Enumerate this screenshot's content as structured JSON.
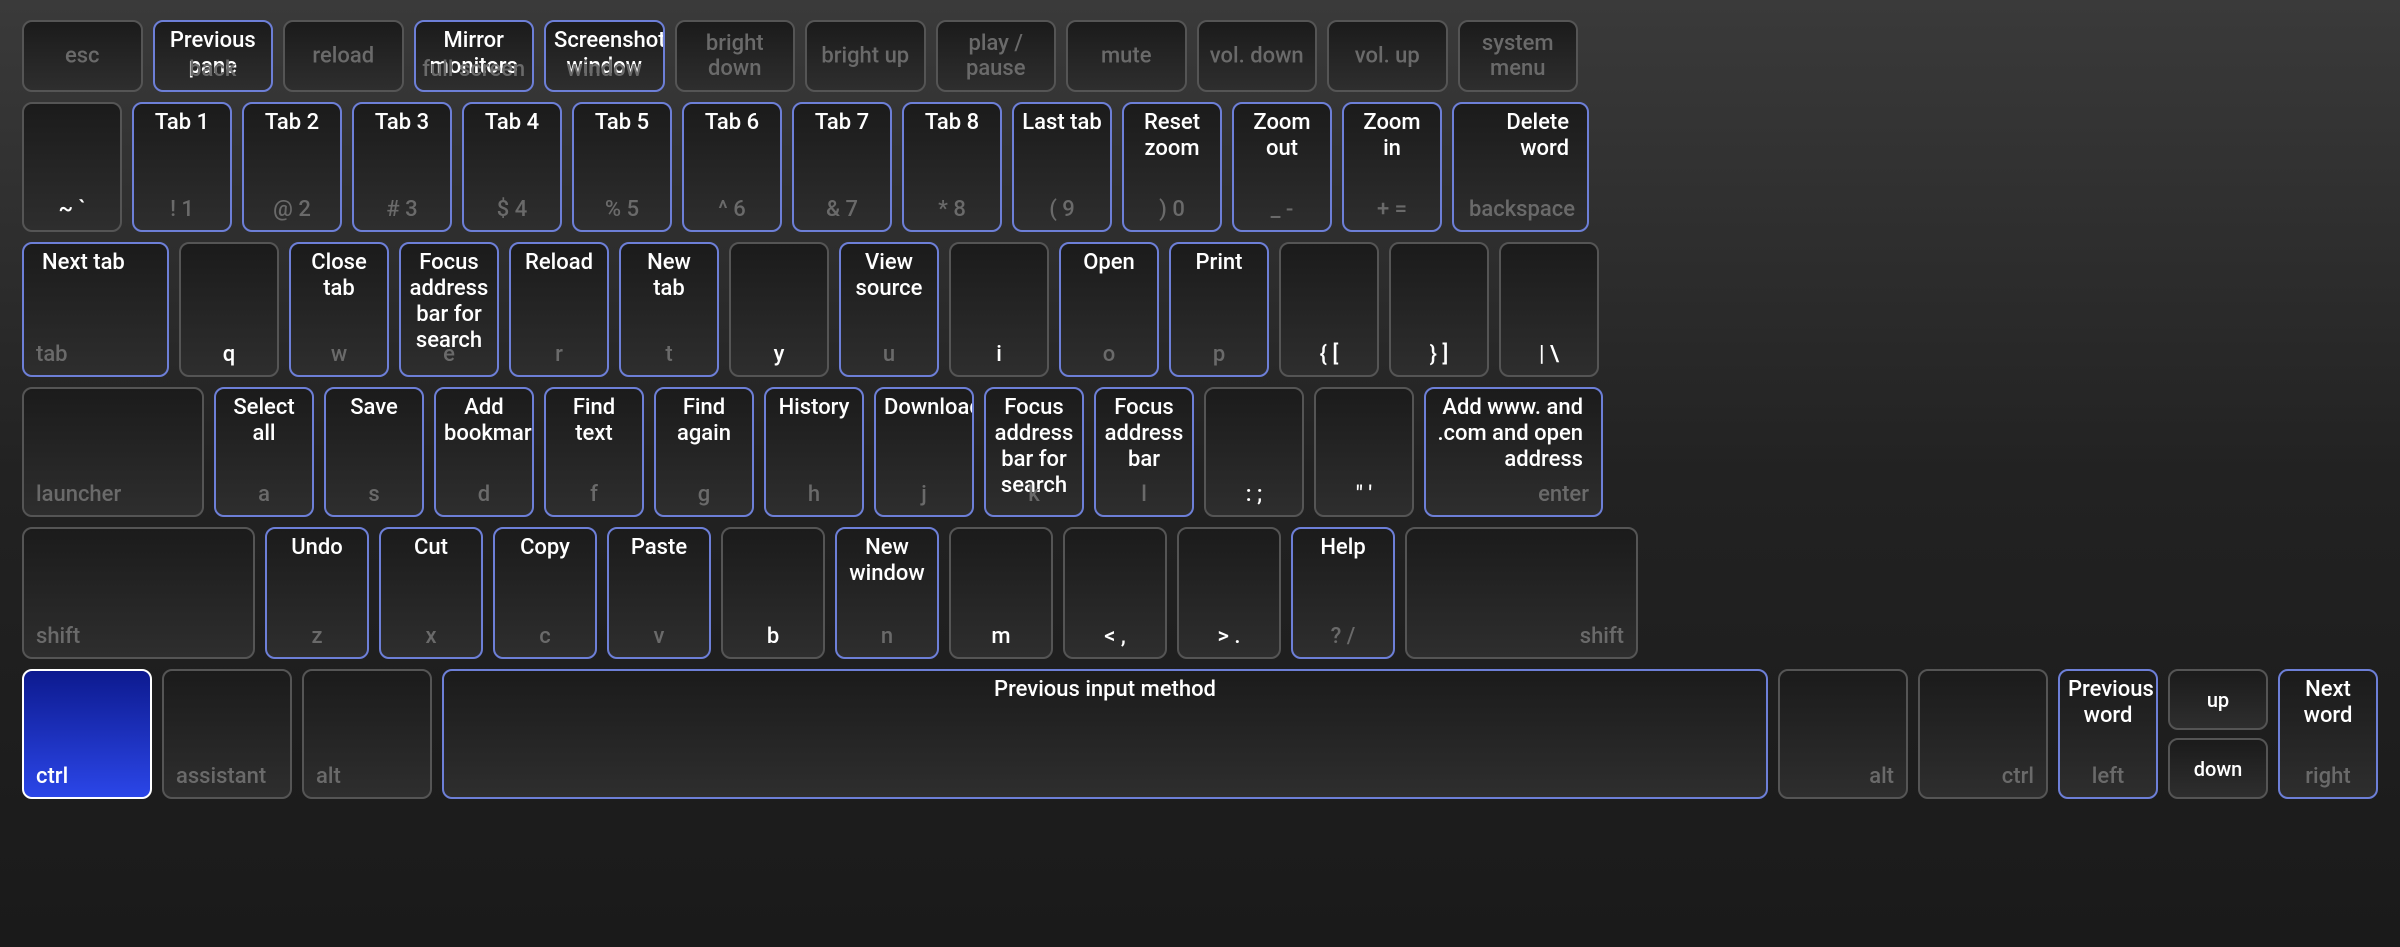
{
  "rows": [
    [
      {
        "id": "esc",
        "glyph": "esc",
        "w": "",
        "gclass": "gl-only",
        "galign": "center"
      },
      {
        "id": "previous-pane",
        "glyph": "back",
        "shortcut": "Previous pane",
        "highlight": true
      },
      {
        "id": "reload-fn",
        "glyph": "reload",
        "gclass": "gl-only"
      },
      {
        "id": "mirror-monitors",
        "glyph": "full screen",
        "shortcut": "Mirror monitors",
        "highlight": true
      },
      {
        "id": "screenshot-window",
        "glyph": "window",
        "shortcut": "Screenshot window",
        "highlight": true
      },
      {
        "id": "bright-down",
        "glyph": "bright down",
        "gclass": "gl-only"
      },
      {
        "id": "bright-up",
        "glyph": "bright up",
        "gclass": "gl-only"
      },
      {
        "id": "play-pause",
        "glyph": "play / pause",
        "gclass": "gl-only"
      },
      {
        "id": "mute",
        "glyph": "mute",
        "gclass": "gl-only"
      },
      {
        "id": "vol-down",
        "glyph": "vol. down",
        "gclass": "gl-only"
      },
      {
        "id": "vol-up",
        "glyph": "vol. up",
        "gclass": "gl-only"
      },
      {
        "id": "system-menu",
        "glyph": "system menu",
        "gclass": "gl-only"
      }
    ],
    [
      {
        "id": "backtick",
        "glyph": "~ `",
        "gbright": true
      },
      {
        "id": "tab-1",
        "glyph": "! 1",
        "shortcut": "Tab 1",
        "highlight": true
      },
      {
        "id": "tab-2",
        "glyph": "@ 2",
        "shortcut": "Tab 2",
        "highlight": true
      },
      {
        "id": "tab-3",
        "glyph": "# 3",
        "shortcut": "Tab 3",
        "highlight": true
      },
      {
        "id": "tab-4",
        "glyph": "$ 4",
        "shortcut": "Tab 4",
        "highlight": true
      },
      {
        "id": "tab-5",
        "glyph": "% 5",
        "shortcut": "Tab 5",
        "highlight": true
      },
      {
        "id": "tab-6",
        "glyph": "^ 6",
        "shortcut": "Tab 6",
        "highlight": true
      },
      {
        "id": "tab-7",
        "glyph": "& 7",
        "shortcut": "Tab 7",
        "highlight": true
      },
      {
        "id": "tab-8",
        "glyph": "* 8",
        "shortcut": "Tab 8",
        "highlight": true
      },
      {
        "id": "last-tab",
        "glyph": "( 9",
        "shortcut": "Last tab",
        "highlight": true
      },
      {
        "id": "reset-zoom",
        "glyph": ") 0",
        "shortcut": "Reset zoom",
        "highlight": true
      },
      {
        "id": "zoom-out",
        "glyph": "_ -",
        "shortcut": "Zoom out",
        "highlight": true
      },
      {
        "id": "zoom-in",
        "glyph": "+ =",
        "shortcut": "Zoom in",
        "highlight": true
      },
      {
        "id": "delete-word",
        "glyph": "backspace",
        "shortcut": "Delete word",
        "salign": "right",
        "galign": "right",
        "cls": "bksp",
        "highlight": true
      }
    ],
    [
      {
        "id": "next-tab",
        "glyph": "tab",
        "shortcut": "Next tab",
        "salign": "left",
        "galign": "left",
        "cls": "tab",
        "highlight": true
      },
      {
        "id": "key-q",
        "glyph": "q",
        "gbright": true
      },
      {
        "id": "close-tab",
        "glyph": "w",
        "shortcut": "Close tab",
        "highlight": true
      },
      {
        "id": "focus-address-search",
        "glyph": "e",
        "shortcut": "Focus address bar for search",
        "highlight": true
      },
      {
        "id": "reload",
        "glyph": "r",
        "shortcut": "Reload",
        "highlight": true
      },
      {
        "id": "new-tab",
        "glyph": "t",
        "shortcut": "New tab",
        "highlight": true
      },
      {
        "id": "key-y",
        "glyph": "y",
        "gbright": true
      },
      {
        "id": "view-source",
        "glyph": "u",
        "shortcut": "View source",
        "highlight": true
      },
      {
        "id": "key-i",
        "glyph": "i",
        "gbright": true
      },
      {
        "id": "open",
        "glyph": "o",
        "shortcut": "Open",
        "highlight": true
      },
      {
        "id": "print",
        "glyph": "p",
        "shortcut": "Print",
        "highlight": true
      },
      {
        "id": "key-lbracket",
        "glyph": "{ [",
        "gbright": true
      },
      {
        "id": "key-rbracket",
        "glyph": "} ]",
        "gbright": true
      },
      {
        "id": "key-backslash",
        "glyph": "| \\",
        "gbright": true
      }
    ],
    [
      {
        "id": "launcher",
        "glyph": "launcher",
        "galign": "left",
        "cls": "launcher"
      },
      {
        "id": "select-all",
        "glyph": "a",
        "shortcut": "Select all",
        "highlight": true
      },
      {
        "id": "save",
        "glyph": "s",
        "shortcut": "Save",
        "highlight": true
      },
      {
        "id": "add-bookmark",
        "glyph": "d",
        "shortcut": "Add bookmark",
        "highlight": true
      },
      {
        "id": "find-text",
        "glyph": "f",
        "shortcut": "Find text",
        "highlight": true
      },
      {
        "id": "find-again",
        "glyph": "g",
        "shortcut": "Find again",
        "highlight": true
      },
      {
        "id": "history",
        "glyph": "h",
        "shortcut": "History",
        "highlight": true
      },
      {
        "id": "downloads",
        "glyph": "j",
        "shortcut": "Downloads",
        "highlight": true
      },
      {
        "id": "focus-address-search-2",
        "glyph": "k",
        "shortcut": "Focus address bar for search",
        "highlight": true
      },
      {
        "id": "focus-address",
        "glyph": "l",
        "shortcut": "Focus address bar",
        "highlight": true
      },
      {
        "id": "key-semicolon",
        "glyph": ": ;",
        "gbright": true
      },
      {
        "id": "key-quote",
        "glyph": "\" '",
        "gbright": true
      },
      {
        "id": "add-www-com",
        "glyph": "enter",
        "shortcut": "Add www. and .com and open address",
        "salign": "right",
        "galign": "right",
        "cls": "enter",
        "highlight": true
      }
    ],
    [
      {
        "id": "shift-left",
        "glyph": "shift",
        "galign": "left",
        "cls": "shift"
      },
      {
        "id": "undo",
        "glyph": "z",
        "shortcut": "Undo",
        "highlight": true
      },
      {
        "id": "cut",
        "glyph": "x",
        "shortcut": "Cut",
        "highlight": true
      },
      {
        "id": "copy",
        "glyph": "c",
        "shortcut": "Copy",
        "highlight": true
      },
      {
        "id": "paste",
        "glyph": "v",
        "shortcut": "Paste",
        "highlight": true
      },
      {
        "id": "key-b",
        "glyph": "b",
        "gbright": true
      },
      {
        "id": "new-window",
        "glyph": "n",
        "shortcut": "New window",
        "highlight": true
      },
      {
        "id": "key-m",
        "glyph": "m",
        "gbright": true
      },
      {
        "id": "key-comma",
        "glyph": "< ,",
        "gbright": true
      },
      {
        "id": "key-period",
        "glyph": "> .",
        "gbright": true
      },
      {
        "id": "help",
        "glyph": "? /",
        "shortcut": "Help",
        "highlight": true
      },
      {
        "id": "shift-right",
        "glyph": "shift",
        "galign": "right",
        "cls": "shift"
      }
    ]
  ],
  "bottom": {
    "ctrl_left": "ctrl",
    "assistant": "assistant",
    "alt_left": "alt",
    "space_shortcut": "Previous input method",
    "alt_right": "alt",
    "ctrl_right": "ctrl",
    "left_shortcut": "Previous word",
    "left_glyph": "left",
    "up_glyph": "up",
    "down_glyph": "down",
    "right_shortcut": "Next word",
    "right_glyph": "right"
  }
}
